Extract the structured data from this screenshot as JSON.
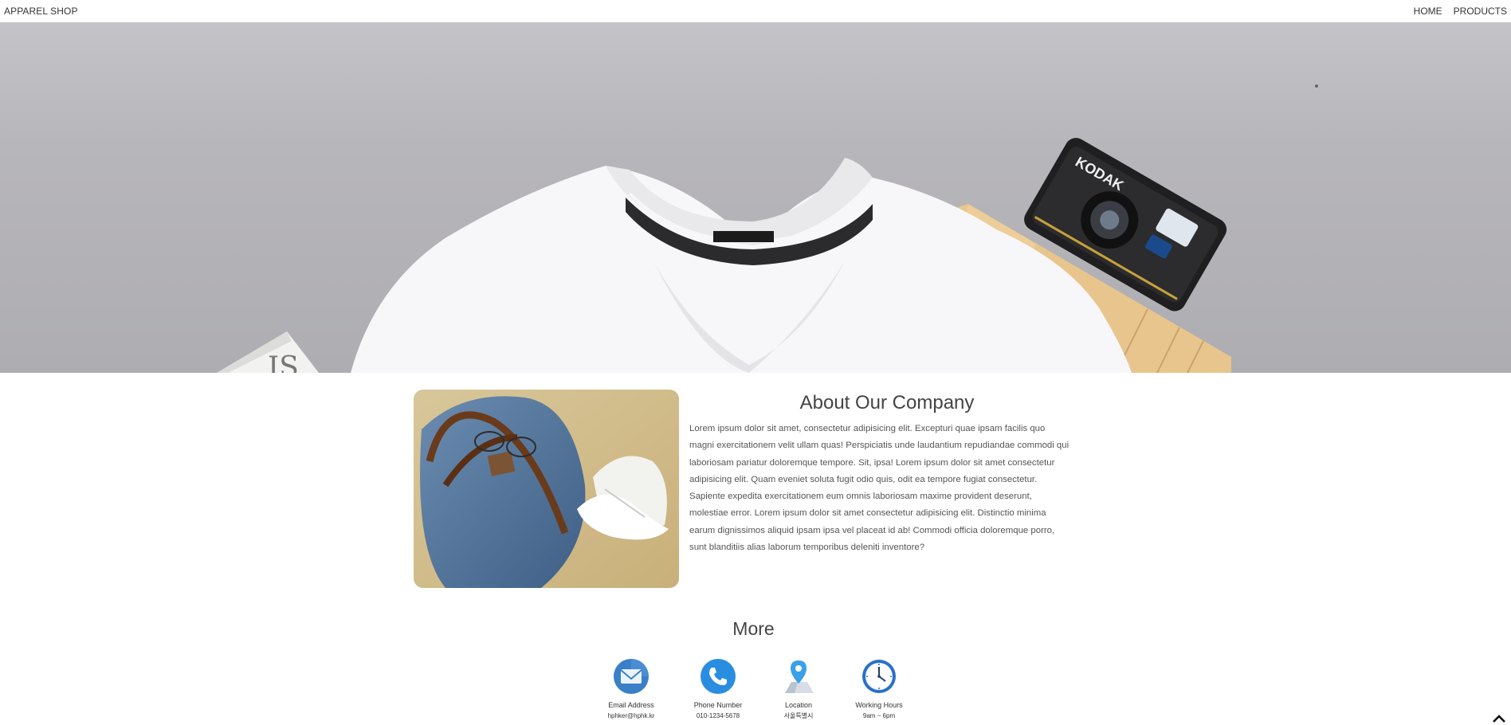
{
  "nav": {
    "brand": "APPAREL SHOP",
    "links": [
      {
        "label": "HOME"
      },
      {
        "label": "PRODUCTS"
      }
    ]
  },
  "hero": {
    "camera_brand": "KODAK"
  },
  "about": {
    "title": "About Our Company",
    "body": "Lorem ipsum dolor sit amet, consectetur adipisicing elit. Excepturi quae ipsam facilis quo magni exercitationem velit ullam quas! Perspiciatis unde laudantium repudiandae commodi qui laboriosam pariatur doloremque tempore. Sit, ipsa! Lorem ipsum dolor sit amet consectetur adipisicing elit. Quam eveniet soluta fugit odio quis, odit ea tempore fugiat consectetur. Sapiente expedita exercitationem eum omnis laboriosam maxime provident deserunt, molestiae error. Lorem ipsum dolor sit amet consectetur adipisicing elit. Distinctio minima earum dignissimos aliquid ipsam ipsa vel placeat id ab! Commodi officia doloremque porro, sunt blanditiis alias laborum temporibus deleniti inventore?"
  },
  "more": {
    "title": "More",
    "items": [
      {
        "label": "Email Address",
        "value": "hphker@hphk.kr",
        "icon": "email-icon"
      },
      {
        "label": "Phone Number",
        "value": "010-1234-5678",
        "icon": "phone-icon"
      },
      {
        "label": "Location",
        "value": "서울특별시",
        "icon": "location-icon"
      },
      {
        "label": "Working Hours",
        "value": "9am ~ 6pm",
        "icon": "clock-icon"
      }
    ]
  },
  "colors": {
    "icon_blue": "#2a8ee0",
    "text": "#444444"
  },
  "icons": {
    "scroll_top": "chevron-up-icon"
  }
}
